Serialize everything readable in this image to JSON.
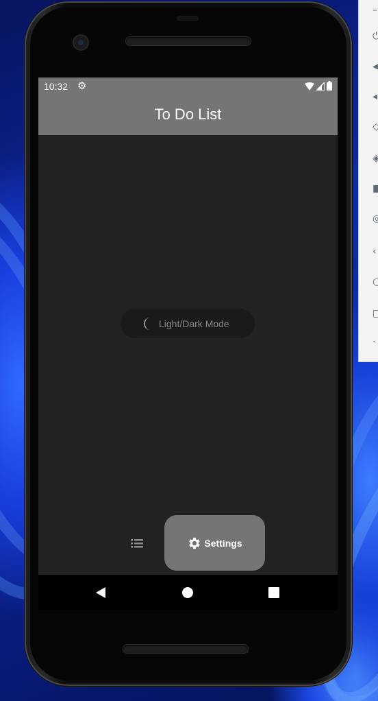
{
  "status_bar": {
    "time": "10:32",
    "icons": [
      "settings-icon",
      "wifi-icon",
      "signal-icon",
      "battery-icon"
    ]
  },
  "app_bar": {
    "title": "To Do List"
  },
  "theme_toggle": {
    "label": "Light/Dark Mode",
    "icon": "moon-icon"
  },
  "bottom_nav": {
    "items": [
      {
        "icon": "list-icon",
        "label": "",
        "selected": false
      },
      {
        "icon": "settings-icon",
        "label": "Settings",
        "selected": true
      }
    ]
  },
  "system_nav": {
    "buttons": [
      "back",
      "home",
      "recents"
    ]
  },
  "colors": {
    "app_bar": "#757575",
    "screen_background": "#222222",
    "selected_nav_pill": "#757575",
    "toggle_background": "#1a1a1a"
  }
}
